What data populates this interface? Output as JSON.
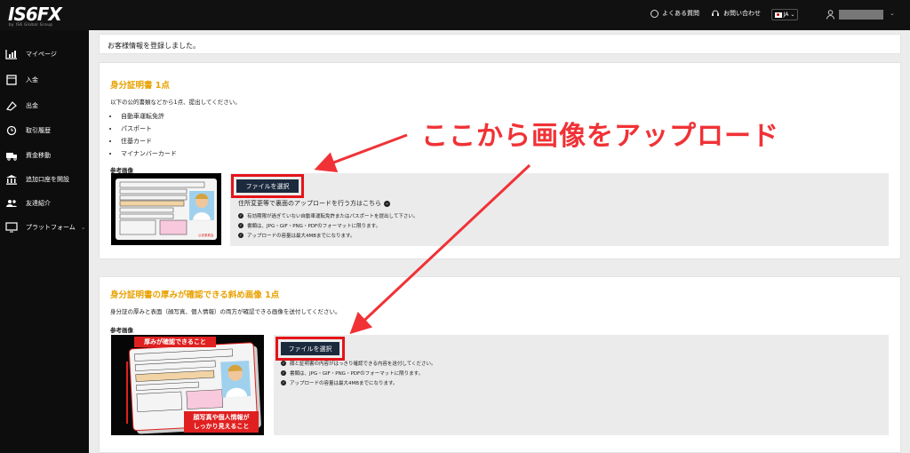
{
  "header": {
    "logo": "IS6FX",
    "logo_sub": "by IS6 Global Group",
    "faq": "よくある質問",
    "contact": "お問い合わせ",
    "lang": "JA"
  },
  "sidebar": {
    "items": [
      {
        "label": "マイページ",
        "icon": "chart-icon"
      },
      {
        "label": "入金",
        "icon": "deposit-icon"
      },
      {
        "label": "出金",
        "icon": "withdraw-icon"
      },
      {
        "label": "取引履歴",
        "icon": "history-icon"
      },
      {
        "label": "資金移動",
        "icon": "transfer-icon"
      },
      {
        "label": "追加口座を開設",
        "icon": "bank-icon"
      },
      {
        "label": "友達紹介",
        "icon": "friends-icon"
      },
      {
        "label": "プラットフォーム",
        "icon": "monitor-icon"
      }
    ]
  },
  "message": "お客様情報を登録しました。",
  "section1": {
    "title": "身分証明書 1点",
    "desc": "以下の公的書類などから1点、提出してください。",
    "bullets": [
      "自動車運転免許",
      "パスポート",
      "住基カード",
      "マイナンバーカード"
    ],
    "ref_label": "参考画像",
    "button": "ファイルを選択",
    "address_link": "住所変更等で裏面のアップロードを行う方はこちら",
    "notes": [
      "有効期限が過ぎていない自動車運転免許またはパスポートを提出して下さい。",
      "書類は、JPG・GIF・PNG・PDFのフォーマットに限ります。",
      "アップロードの容量は最大4MBまでになります。"
    ]
  },
  "section2": {
    "title": "身分証明書の厚みが確認できる斜め画像 1点",
    "desc": "身分証の厚みと表面（顔写真、個人情報）の両方が確認できる画像を送付してください。",
    "ref_label": "参考画像",
    "button": "ファイルを選択",
    "img_label1": "厚みが確認できること",
    "img_label2a": "顔写真や個人情報が",
    "img_label2b": "しっかり見えること",
    "notes": [
      "顔と証明書の内容がはっきり確認できる内容を送付してください。",
      "書類は、JPG・GIF・PNG・PDFのフォーマットに限ります。",
      "アップロードの容量は最大4MBまでになります。"
    ]
  },
  "annotation": "ここから画像をアップロード",
  "colors": {
    "accent": "#e8a100",
    "annotation": "#f03236",
    "button": "#1c2a3e"
  }
}
